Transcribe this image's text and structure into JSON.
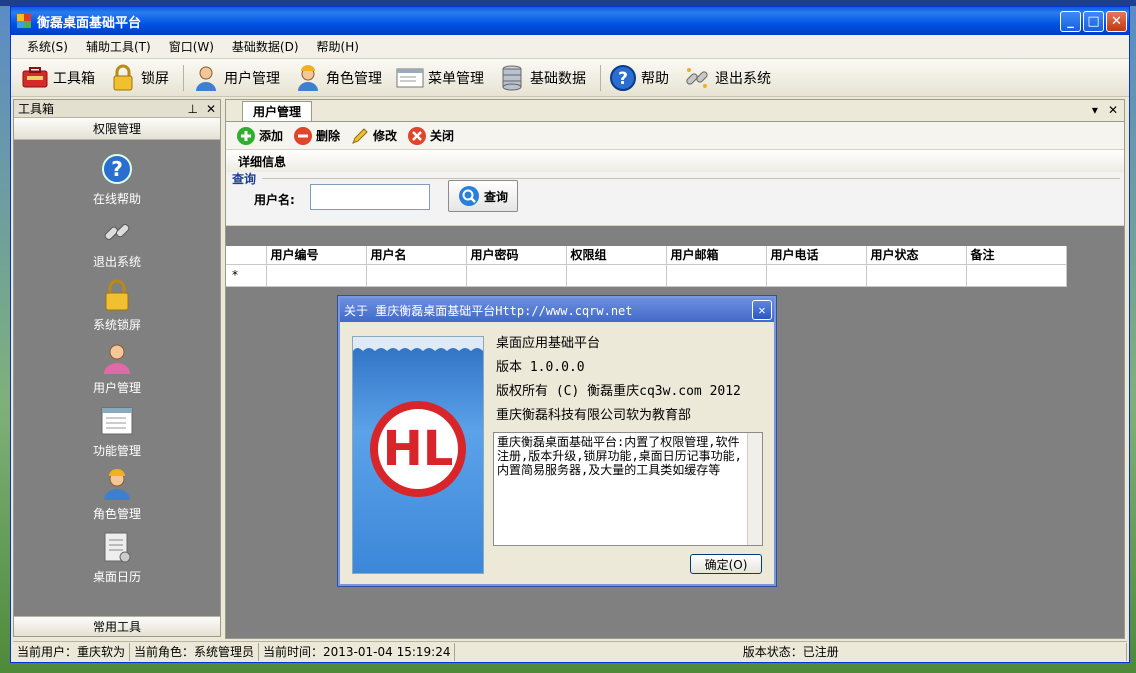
{
  "window": {
    "title": "衡磊桌面基础平台"
  },
  "menu": [
    "系统(S)",
    "辅助工具(T)",
    "窗口(W)",
    "基础数据(D)",
    "帮助(H)"
  ],
  "toolbar": [
    "工具箱",
    "锁屏",
    "用户管理",
    "角色管理",
    "菜单管理",
    "基础数据",
    "帮助",
    "退出系统"
  ],
  "toolbox": {
    "title": "工具箱",
    "group": "权限管理",
    "items": [
      "在线帮助",
      "退出系统",
      "系统锁屏",
      "用户管理",
      "功能管理",
      "角色管理",
      "桌面日历"
    ],
    "footer": "常用工具"
  },
  "tab": {
    "label": "用户管理"
  },
  "doc_toolbar": [
    "添加",
    "删除",
    "修改",
    "关闭"
  ],
  "detail_title": "详细信息",
  "query": {
    "legend": "查询",
    "label": "用户名:",
    "value": "",
    "button": "查询"
  },
  "grid": {
    "columns": [
      "用户编号",
      "用户名",
      "用户密码",
      "权限组",
      "用户邮箱",
      "用户电话",
      "用户状态",
      "备注"
    ],
    "new_row_marker": "*"
  },
  "status": {
    "user": "当前用户：重庆软为",
    "role": "当前角色：系统管理员",
    "time": "当前时间：2013-01-04 15:19:24",
    "version": "版本状态：已注册"
  },
  "about": {
    "title": "关于 重庆衡磊桌面基础平台Http://www.cqrw.net",
    "product": "桌面应用基础平台",
    "version": "版本 1.0.0.0",
    "copyright": "版权所有 (C) 衡磊重庆cq3w.com 2012",
    "company": "重庆衡磊科技有限公司软为教育部",
    "description": "重庆衡磊桌面基础平台:内置了权限管理,软件注册,版本升级,锁屏功能,桌面日历记事功能,内置简易服务器,及大量的工具类如缓存等",
    "ok": "确定(O)"
  }
}
